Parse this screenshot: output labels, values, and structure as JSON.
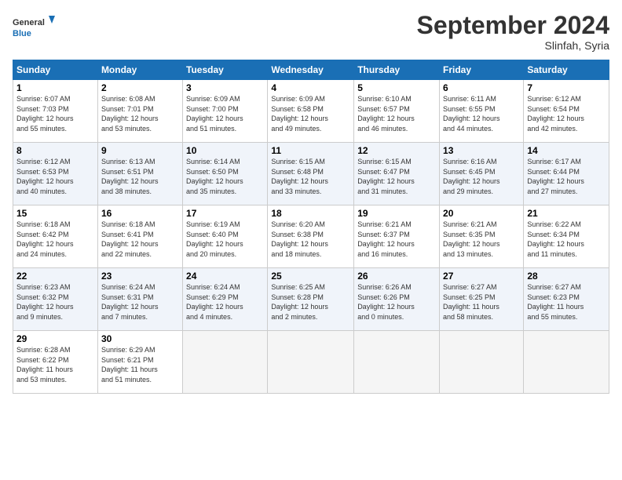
{
  "header": {
    "logo_line1": "General",
    "logo_line2": "Blue",
    "title": "September 2024",
    "location": "Slinfah, Syria"
  },
  "weekdays": [
    "Sunday",
    "Monday",
    "Tuesday",
    "Wednesday",
    "Thursday",
    "Friday",
    "Saturday"
  ],
  "weeks": [
    [
      {
        "day": "1",
        "info": "Sunrise: 6:07 AM\nSunset: 7:03 PM\nDaylight: 12 hours\nand 55 minutes."
      },
      {
        "day": "2",
        "info": "Sunrise: 6:08 AM\nSunset: 7:01 PM\nDaylight: 12 hours\nand 53 minutes."
      },
      {
        "day": "3",
        "info": "Sunrise: 6:09 AM\nSunset: 7:00 PM\nDaylight: 12 hours\nand 51 minutes."
      },
      {
        "day": "4",
        "info": "Sunrise: 6:09 AM\nSunset: 6:58 PM\nDaylight: 12 hours\nand 49 minutes."
      },
      {
        "day": "5",
        "info": "Sunrise: 6:10 AM\nSunset: 6:57 PM\nDaylight: 12 hours\nand 46 minutes."
      },
      {
        "day": "6",
        "info": "Sunrise: 6:11 AM\nSunset: 6:55 PM\nDaylight: 12 hours\nand 44 minutes."
      },
      {
        "day": "7",
        "info": "Sunrise: 6:12 AM\nSunset: 6:54 PM\nDaylight: 12 hours\nand 42 minutes."
      }
    ],
    [
      {
        "day": "8",
        "info": "Sunrise: 6:12 AM\nSunset: 6:53 PM\nDaylight: 12 hours\nand 40 minutes."
      },
      {
        "day": "9",
        "info": "Sunrise: 6:13 AM\nSunset: 6:51 PM\nDaylight: 12 hours\nand 38 minutes."
      },
      {
        "day": "10",
        "info": "Sunrise: 6:14 AM\nSunset: 6:50 PM\nDaylight: 12 hours\nand 35 minutes."
      },
      {
        "day": "11",
        "info": "Sunrise: 6:15 AM\nSunset: 6:48 PM\nDaylight: 12 hours\nand 33 minutes."
      },
      {
        "day": "12",
        "info": "Sunrise: 6:15 AM\nSunset: 6:47 PM\nDaylight: 12 hours\nand 31 minutes."
      },
      {
        "day": "13",
        "info": "Sunrise: 6:16 AM\nSunset: 6:45 PM\nDaylight: 12 hours\nand 29 minutes."
      },
      {
        "day": "14",
        "info": "Sunrise: 6:17 AM\nSunset: 6:44 PM\nDaylight: 12 hours\nand 27 minutes."
      }
    ],
    [
      {
        "day": "15",
        "info": "Sunrise: 6:18 AM\nSunset: 6:42 PM\nDaylight: 12 hours\nand 24 minutes."
      },
      {
        "day": "16",
        "info": "Sunrise: 6:18 AM\nSunset: 6:41 PM\nDaylight: 12 hours\nand 22 minutes."
      },
      {
        "day": "17",
        "info": "Sunrise: 6:19 AM\nSunset: 6:40 PM\nDaylight: 12 hours\nand 20 minutes."
      },
      {
        "day": "18",
        "info": "Sunrise: 6:20 AM\nSunset: 6:38 PM\nDaylight: 12 hours\nand 18 minutes."
      },
      {
        "day": "19",
        "info": "Sunrise: 6:21 AM\nSunset: 6:37 PM\nDaylight: 12 hours\nand 16 minutes."
      },
      {
        "day": "20",
        "info": "Sunrise: 6:21 AM\nSunset: 6:35 PM\nDaylight: 12 hours\nand 13 minutes."
      },
      {
        "day": "21",
        "info": "Sunrise: 6:22 AM\nSunset: 6:34 PM\nDaylight: 12 hours\nand 11 minutes."
      }
    ],
    [
      {
        "day": "22",
        "info": "Sunrise: 6:23 AM\nSunset: 6:32 PM\nDaylight: 12 hours\nand 9 minutes."
      },
      {
        "day": "23",
        "info": "Sunrise: 6:24 AM\nSunset: 6:31 PM\nDaylight: 12 hours\nand 7 minutes."
      },
      {
        "day": "24",
        "info": "Sunrise: 6:24 AM\nSunset: 6:29 PM\nDaylight: 12 hours\nand 4 minutes."
      },
      {
        "day": "25",
        "info": "Sunrise: 6:25 AM\nSunset: 6:28 PM\nDaylight: 12 hours\nand 2 minutes."
      },
      {
        "day": "26",
        "info": "Sunrise: 6:26 AM\nSunset: 6:26 PM\nDaylight: 12 hours\nand 0 minutes."
      },
      {
        "day": "27",
        "info": "Sunrise: 6:27 AM\nSunset: 6:25 PM\nDaylight: 11 hours\nand 58 minutes."
      },
      {
        "day": "28",
        "info": "Sunrise: 6:27 AM\nSunset: 6:23 PM\nDaylight: 11 hours\nand 55 minutes."
      }
    ],
    [
      {
        "day": "29",
        "info": "Sunrise: 6:28 AM\nSunset: 6:22 PM\nDaylight: 11 hours\nand 53 minutes."
      },
      {
        "day": "30",
        "info": "Sunrise: 6:29 AM\nSunset: 6:21 PM\nDaylight: 11 hours\nand 51 minutes."
      },
      {
        "day": "",
        "info": ""
      },
      {
        "day": "",
        "info": ""
      },
      {
        "day": "",
        "info": ""
      },
      {
        "day": "",
        "info": ""
      },
      {
        "day": "",
        "info": ""
      }
    ]
  ]
}
